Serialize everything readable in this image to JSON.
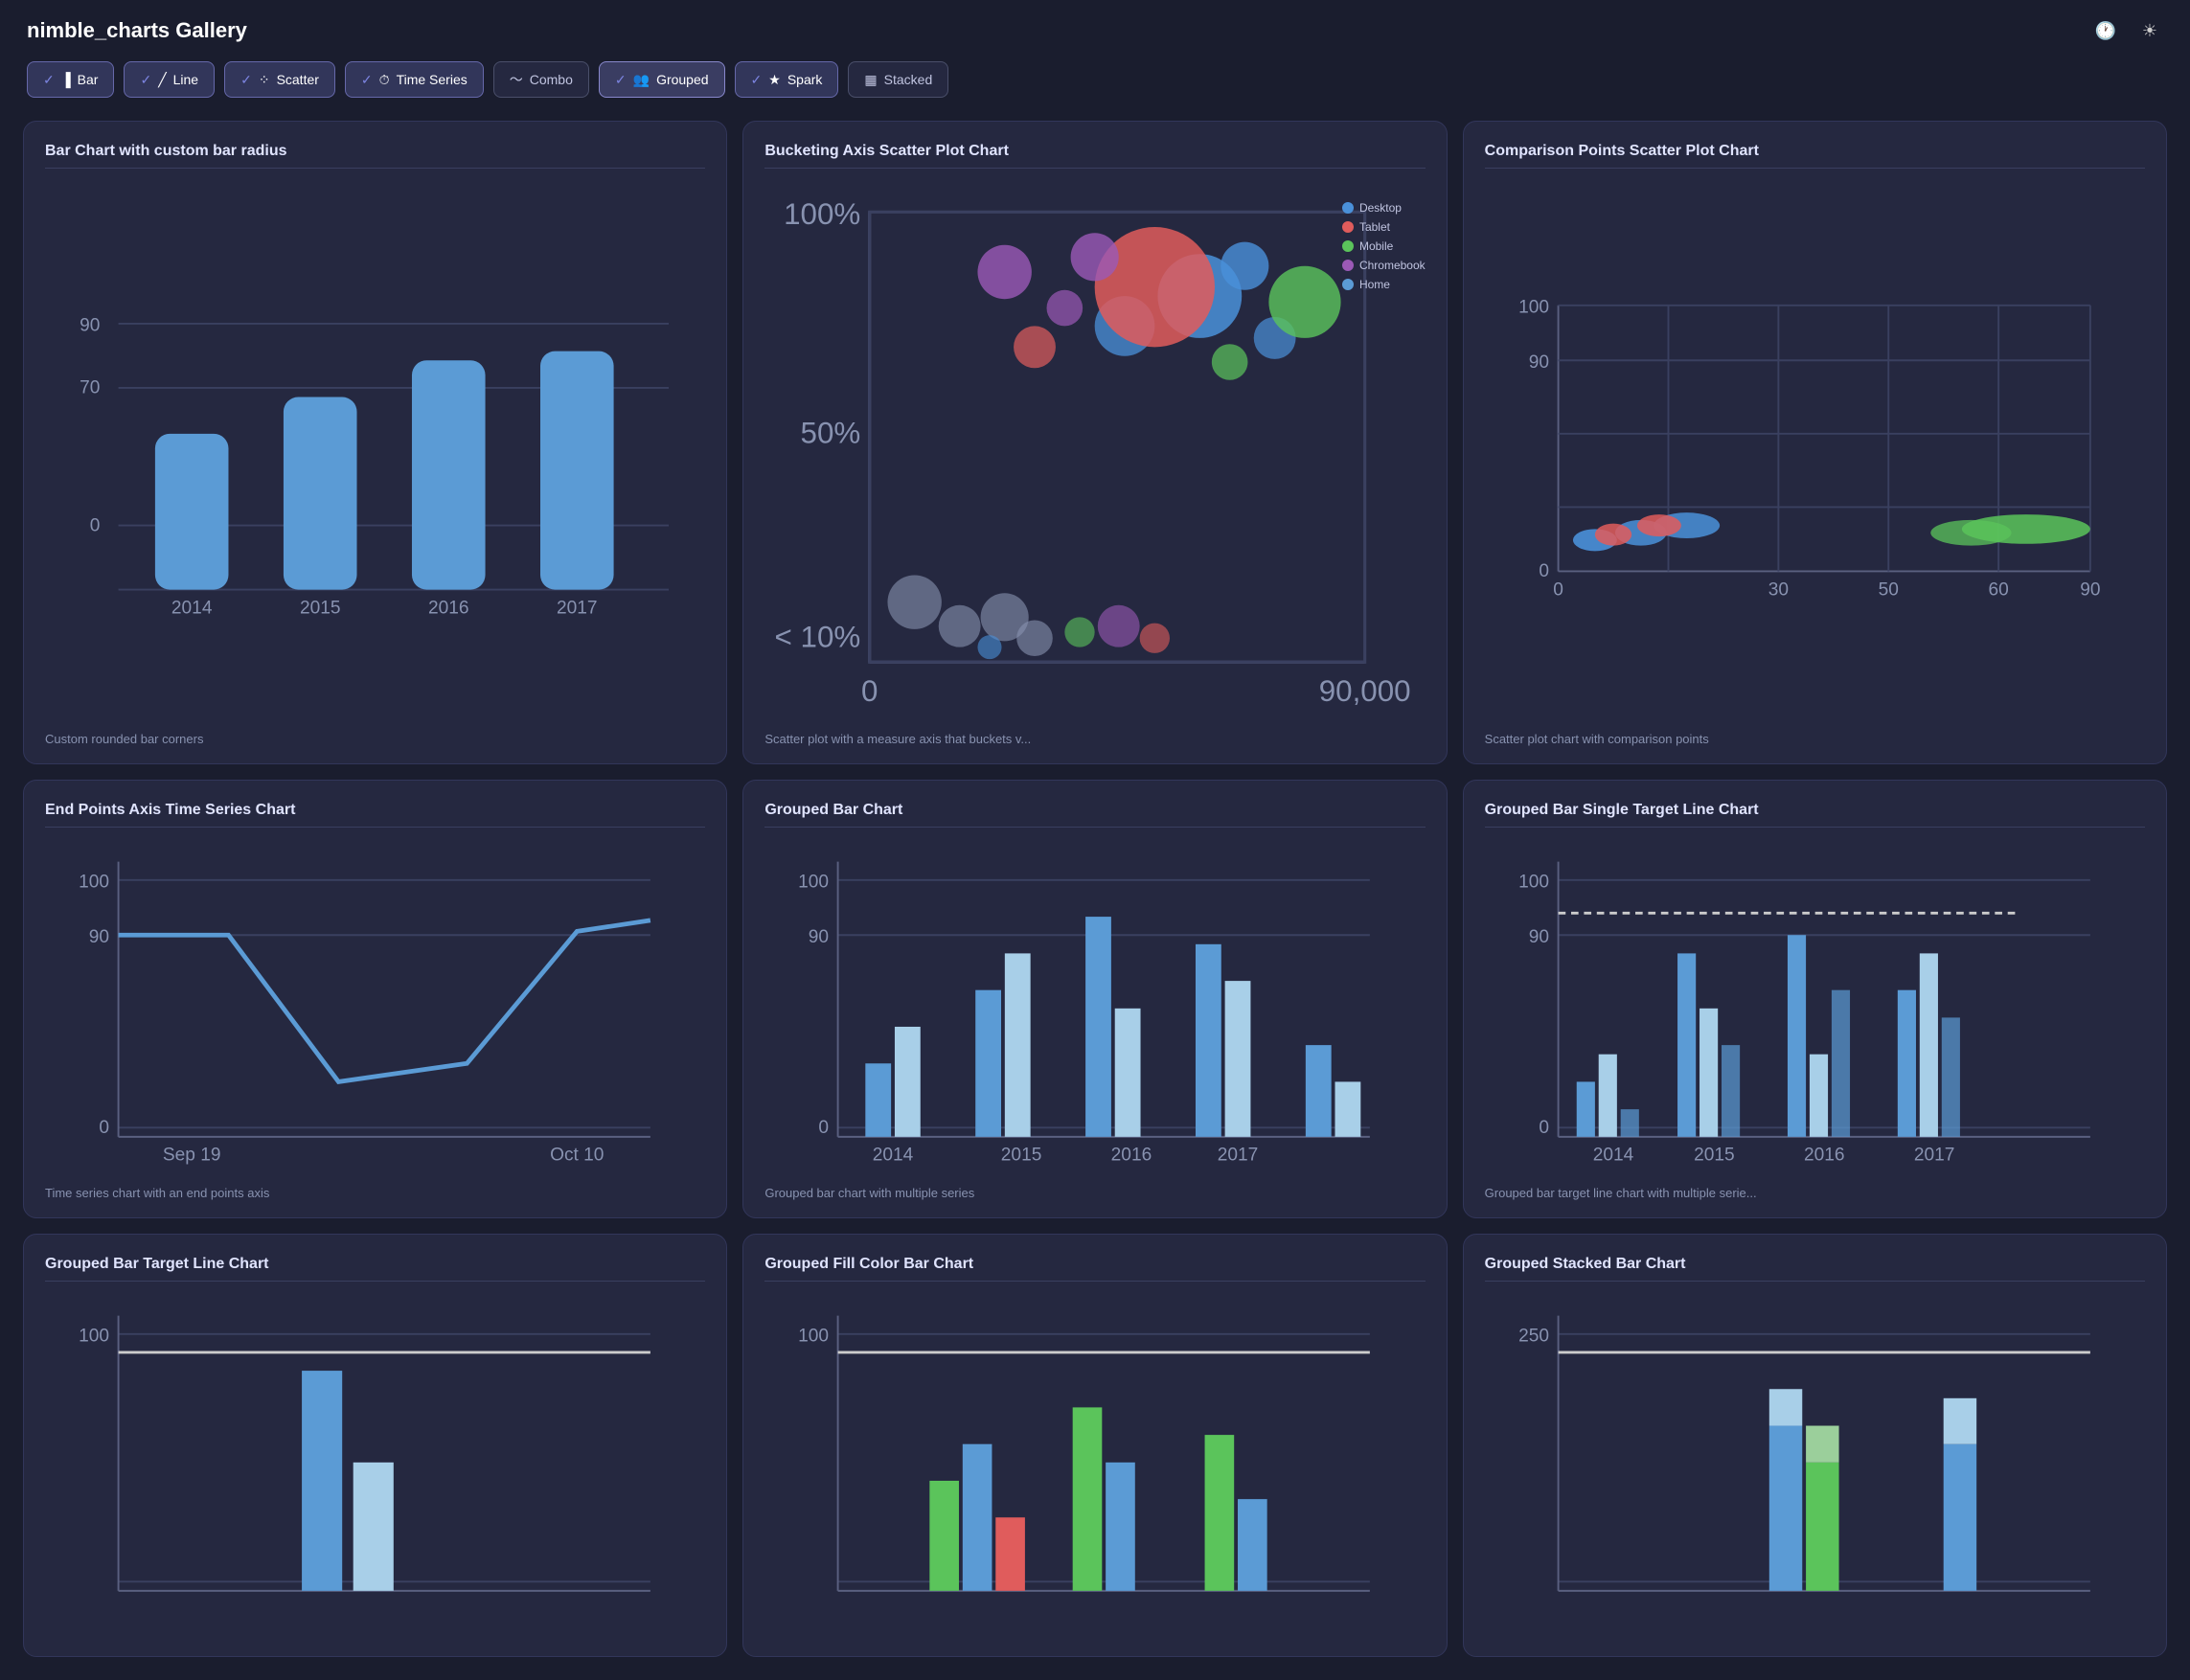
{
  "app": {
    "title": "nimble_charts Gallery"
  },
  "header": {
    "history_icon": "🕐",
    "theme_icon": "☀"
  },
  "filters": [
    {
      "label": "Bar",
      "active": true,
      "checked": true,
      "icon": "bar-chart-icon"
    },
    {
      "label": "Line",
      "active": false,
      "checked": true,
      "icon": "line-chart-icon"
    },
    {
      "label": "Scatter",
      "active": false,
      "checked": true,
      "icon": "scatter-icon"
    },
    {
      "label": "Time Series",
      "active": false,
      "checked": true,
      "icon": "clock-icon"
    },
    {
      "label": "Combo",
      "active": false,
      "checked": false,
      "icon": "combo-icon"
    },
    {
      "label": "Grouped",
      "active": true,
      "checked": true,
      "highlighted": true,
      "icon": "grouped-icon"
    },
    {
      "label": "Spark",
      "active": false,
      "checked": true,
      "icon": "spark-icon"
    },
    {
      "label": "Stacked",
      "active": false,
      "checked": false,
      "icon": "stacked-icon"
    }
  ],
  "charts": [
    {
      "id": "bar-custom-radius",
      "title": "Bar Chart with custom bar radius",
      "description": "Custom rounded bar corners",
      "type": "bar",
      "badge": "70"
    },
    {
      "id": "bucketing-scatter",
      "title": "Bucketing Axis Scatter Plot Chart",
      "description": "Scatter plot with a measure axis that buckets v...",
      "type": "scatter-bucket",
      "legend": [
        "Desktop",
        "Tablet",
        "Mobile",
        "Chromebook",
        "Home"
      ]
    },
    {
      "id": "comparison-scatter",
      "title": "Comparison Points Scatter Plot Chart",
      "description": "Scatter plot chart with comparison points",
      "type": "scatter-comparison"
    },
    {
      "id": "end-points-timeseries",
      "title": "End Points Axis Time Series Chart",
      "description": "Time series chart with an end points axis",
      "type": "timeseries"
    },
    {
      "id": "grouped-bar",
      "title": "Grouped Bar Chart",
      "description": "Grouped bar chart with multiple series",
      "type": "grouped-bar"
    },
    {
      "id": "grouped-bar-single-target",
      "title": "Grouped Bar Single Target Line Chart",
      "description": "Grouped bar target line chart with multiple serie...",
      "type": "grouped-bar-target"
    },
    {
      "id": "grouped-bar-target-line",
      "title": "Grouped Bar Target Line Chart",
      "description": "",
      "type": "grouped-bar-target-bottom",
      "badge": "100"
    },
    {
      "id": "grouped-fill-color",
      "title": "Grouped Fill Color Bar Chart",
      "description": "",
      "type": "grouped-fill-color",
      "badge": "100"
    },
    {
      "id": "grouped-stacked",
      "title": "Grouped Stacked Bar Chart",
      "description": "",
      "type": "grouped-stacked",
      "badge": "250"
    }
  ],
  "colors": {
    "bar_blue": "#5b9bd5",
    "bar_light": "#90bfe0",
    "bar_teal": "#4ecdc4",
    "line_blue": "#5b9bd5",
    "scatter_desktop": "#4a90d9",
    "scatter_tablet": "#e05c5c",
    "scatter_mobile": "#5bc45b",
    "scatter_chromebook": "#9b59b6",
    "scatter_home": "#5b9bd5",
    "grouped_dark": "#5b9bd5",
    "grouped_light": "#a8cfe8",
    "green": "#5bc45b",
    "red": "#e05c5c",
    "orange": "#e8944a"
  }
}
